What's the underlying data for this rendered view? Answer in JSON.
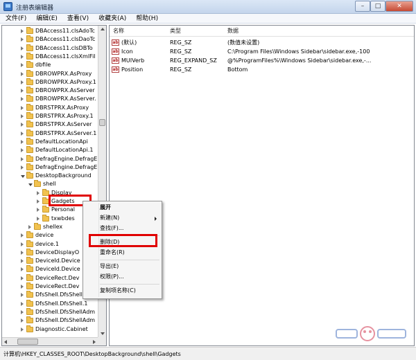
{
  "window": {
    "title": "注册表编辑器",
    "minimize": "–",
    "maximize": "□",
    "close": "✕"
  },
  "menubar": {
    "items": [
      "文件(F)",
      "编辑(E)",
      "查看(V)",
      "收藏夹(A)",
      "帮助(H)"
    ]
  },
  "tree": {
    "items": [
      {
        "label": "DBAccess11.clsAdoTc",
        "depth": 2,
        "state": "collapsed"
      },
      {
        "label": "DBAccess11.clsDaoTc",
        "depth": 2,
        "state": "collapsed"
      },
      {
        "label": "DBAccess11.clsDBTo",
        "depth": 2,
        "state": "collapsed"
      },
      {
        "label": "DBAccess11.clsXmlFil",
        "depth": 2,
        "state": "collapsed"
      },
      {
        "label": "dbfile",
        "depth": 2,
        "state": "collapsed"
      },
      {
        "label": "DBROWPRX.AsProxy",
        "depth": 2,
        "state": "collapsed"
      },
      {
        "label": "DBROWPRX.AsProxy.1",
        "depth": 2,
        "state": "collapsed"
      },
      {
        "label": "DBROWPRX.AsServer",
        "depth": 2,
        "state": "collapsed"
      },
      {
        "label": "DBROWPRX.AsServer.",
        "depth": 2,
        "state": "collapsed"
      },
      {
        "label": "DBRSTPRX.AsProxy",
        "depth": 2,
        "state": "collapsed"
      },
      {
        "label": "DBRSTPRX.AsProxy.1",
        "depth": 2,
        "state": "collapsed"
      },
      {
        "label": "DBRSTPRX.AsServer",
        "depth": 2,
        "state": "collapsed"
      },
      {
        "label": "DBRSTPRX.AsServer.1",
        "depth": 2,
        "state": "collapsed"
      },
      {
        "label": "DefaultLocationApi",
        "depth": 2,
        "state": "collapsed"
      },
      {
        "label": "DefaultLocationApi.1",
        "depth": 2,
        "state": "collapsed"
      },
      {
        "label": "DefragEngine.DefragE",
        "depth": 2,
        "state": "collapsed"
      },
      {
        "label": "DefragEngine.DefragE",
        "depth": 2,
        "state": "collapsed"
      },
      {
        "label": "DesktopBackground",
        "depth": 2,
        "state": "expanded"
      },
      {
        "label": "shell",
        "depth": 3,
        "state": "expanded"
      },
      {
        "label": "Display",
        "depth": 4,
        "state": "collapsed"
      },
      {
        "label": "Gadgets",
        "depth": 4,
        "state": "collapsed"
      },
      {
        "label": "Personal",
        "depth": 4,
        "state": "collapsed"
      },
      {
        "label": "txwbdes",
        "depth": 4,
        "state": "collapsed"
      },
      {
        "label": "shellex",
        "depth": 3,
        "state": "collapsed"
      },
      {
        "label": "device",
        "depth": 2,
        "state": "collapsed"
      },
      {
        "label": "device.1",
        "depth": 2,
        "state": "collapsed"
      },
      {
        "label": "DeviceDisplayO",
        "depth": 2,
        "state": "collapsed"
      },
      {
        "label": "DeviceId.Device",
        "depth": 2,
        "state": "collapsed"
      },
      {
        "label": "DeviceId.Device",
        "depth": 2,
        "state": "collapsed"
      },
      {
        "label": "DeviceRect.Dev",
        "depth": 2,
        "state": "collapsed"
      },
      {
        "label": "DeviceRect.Dev",
        "depth": 2,
        "state": "collapsed"
      },
      {
        "label": "DfsShell.DfsShell",
        "depth": 2,
        "state": "collapsed"
      },
      {
        "label": "DfsShell.DfsShell.1",
        "depth": 2,
        "state": "collapsed"
      },
      {
        "label": "DfsShell.DfsShellAdm",
        "depth": 2,
        "state": "collapsed"
      },
      {
        "label": "DfsShell.DfsShellAdm",
        "depth": 2,
        "state": "collapsed"
      },
      {
        "label": "Diagnostic.Cabinet",
        "depth": 2,
        "state": "collapsed"
      }
    ]
  },
  "list": {
    "headers": {
      "name": "名称",
      "type": "类型",
      "data": "数据"
    },
    "rows": [
      {
        "icon": "ab",
        "name": "(默认)",
        "type": "REG_SZ",
        "data": "(数值未设置)"
      },
      {
        "icon": "ab",
        "name": "Icon",
        "type": "REG_SZ",
        "data": "C:\\Program Files\\Windows Sidebar\\sidebar.exe,-100"
      },
      {
        "icon": "ab",
        "name": "MUIVerb",
        "type": "REG_EXPAND_SZ",
        "data": "@%ProgramFiles%\\Windows Sidebar\\sidebar.exe,-..."
      },
      {
        "icon": "ab",
        "name": "Position",
        "type": "REG_SZ",
        "data": "Bottom"
      }
    ]
  },
  "context_menu": {
    "expand": "展开",
    "new": "新建(N)",
    "find": "查找(F)...",
    "delete": "删除(D)",
    "rename": "重命名(R)",
    "export": "导出(E)",
    "permissions": "权限(P)...",
    "copy_key_name": "复制项名称(C)"
  },
  "statusbar": {
    "path": "计算机\\HKEY_CLASSES_ROOT\\DesktopBackground\\shell\\Gadgets"
  },
  "colors": {
    "highlight_box": "#e00000"
  }
}
